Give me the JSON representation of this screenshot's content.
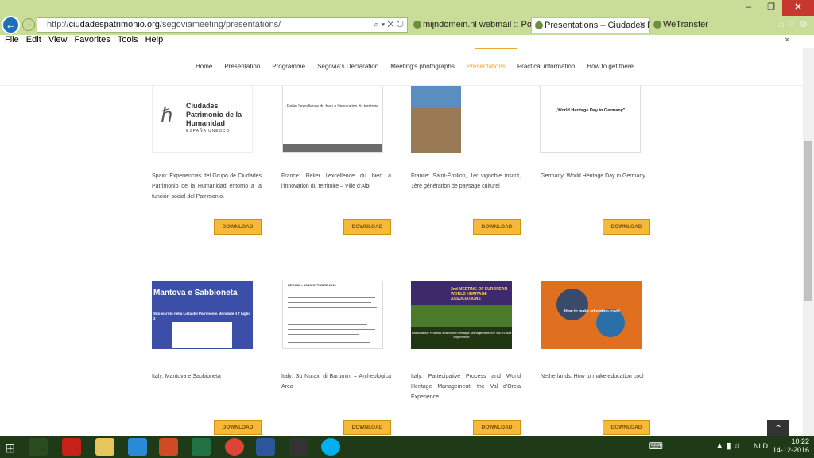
{
  "browser": {
    "url_prefix": "http://",
    "url_domain": "ciudadespatrimonio.org",
    "url_path": "/segoviameeting/presentations/",
    "url_icons": "⌕ ▾ ✕ ↻",
    "tabs": [
      {
        "label": "mijndomein.nl webmail :: Post..."
      },
      {
        "label": "Presentations – Ciudades P..."
      },
      {
        "label": "WeTransfer"
      }
    ],
    "menu": [
      "File",
      "Edit",
      "View",
      "Favorites",
      "Tools",
      "Help"
    ]
  },
  "nav": {
    "items": [
      "Home",
      "Presentation",
      "Programme",
      "Segovia's Declaration",
      "Meeting's photographs",
      "Presentations",
      "Practical information",
      "How to get there"
    ],
    "active_index": 5
  },
  "images": {
    "ciudades_title": "Ciudades Patrimonio de la Humanidad",
    "ciudades_sub": "ESPAÑA UNESCO",
    "france_text": "Relier l'excellence du bien à l'innovation du territoire",
    "germany_text": "„World Heritage Day in Germany\"",
    "mantova_title": "Mantova e Sabbioneta",
    "mantova_sub": "Sito iscritto nella Lista del Patrimonio Mondiale il 7 luglio 2",
    "nuraxi_heading": "REGGIA – 20/21 OTTOBRE 2016",
    "valdorcia_top": "2nd MEETING OF EUROPEAN WORLD HERITAGE ASSOCIATIONS",
    "valdorcia_bottom": "Participative Process and World Heritage Management: the Val d'Orcia Experience",
    "valdorcia_author": "Paolo Felini",
    "edu_text": "How to make education 'cool'"
  },
  "cards": [
    {
      "title": "Spain: Experiencias del Grupo de Ciudades Patrimonio de la Humanidad entorno a la función social del Patrimonio.",
      "download": "DOWNLOAD"
    },
    {
      "title": "France: Relier l'excellence du bien à l'innovation du territoire – Ville d'Albi",
      "download": "DOWNLOAD"
    },
    {
      "title": "France: Saint-Émilion, 1er vignoble inscrit, 1ère génération de paysage culturel",
      "download": "DOWNLOAD"
    },
    {
      "title": "Germany: World Heritage Day in Germany",
      "download": "DOWNLOAD"
    },
    {
      "title": "Italy: Mantova e Sabbioneta",
      "download": "DOWNLOAD"
    },
    {
      "title": "Italy: Su Nuraxi di Barumini – Archeologica Area",
      "download": "DOWNLOAD"
    },
    {
      "title": "Italy: Partecipative Process and World Heritage Management: the Val d'Orcia Experience",
      "download": "DOWNLOAD"
    },
    {
      "title": "Netherlands: How to make education cool",
      "download": "DOWNLOAD"
    }
  ],
  "taskbar": {
    "lang": "NLD",
    "time": "10:22",
    "date": "14-12-2016"
  },
  "colors": {
    "accent": "#f0a830",
    "download_button": "#f6b93a",
    "browser_chrome": "#c9dd98"
  }
}
